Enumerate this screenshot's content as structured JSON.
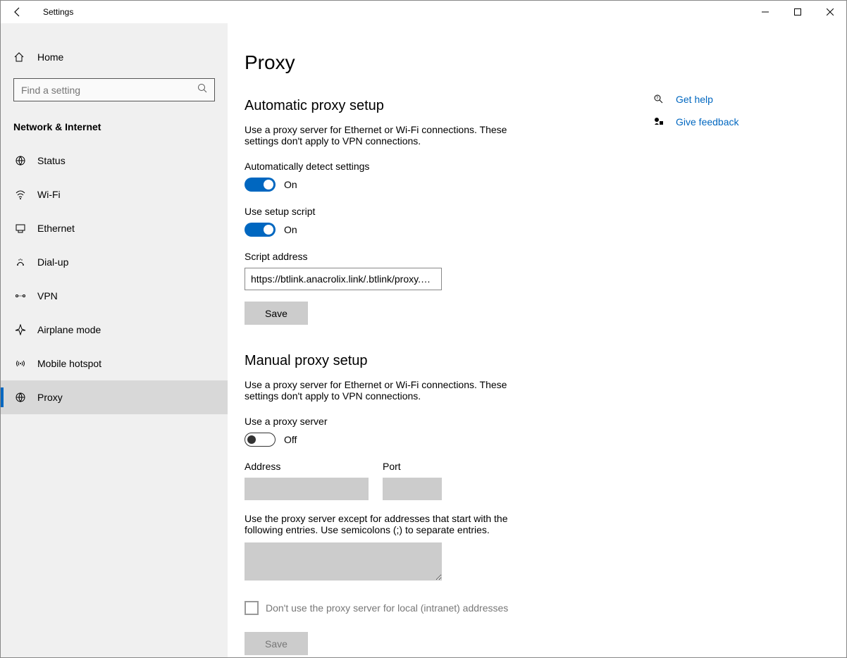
{
  "window": {
    "title": "Settings"
  },
  "sidebar": {
    "home_label": "Home",
    "search_placeholder": "Find a setting",
    "category_label": "Network & Internet",
    "items": [
      {
        "label": "Status"
      },
      {
        "label": "Wi-Fi"
      },
      {
        "label": "Ethernet"
      },
      {
        "label": "Dial-up"
      },
      {
        "label": "VPN"
      },
      {
        "label": "Airplane mode"
      },
      {
        "label": "Mobile hotspot"
      },
      {
        "label": "Proxy"
      }
    ]
  },
  "page": {
    "title": "Proxy"
  },
  "auto": {
    "heading": "Automatic proxy setup",
    "desc": "Use a proxy server for Ethernet or Wi-Fi connections. These settings don't apply to VPN connections.",
    "detect_label": "Automatically detect settings",
    "detect_state": "On",
    "script_toggle_label": "Use setup script",
    "script_toggle_state": "On",
    "script_addr_label": "Script address",
    "script_addr_value": "https://btlink.anacrolix.link/.btlink/proxy.pac",
    "save_label": "Save"
  },
  "manual": {
    "heading": "Manual proxy setup",
    "desc": "Use a proxy server for Ethernet or Wi-Fi connections. These settings don't apply to VPN connections.",
    "use_label": "Use a proxy server",
    "use_state": "Off",
    "address_label": "Address",
    "port_label": "Port",
    "except_desc": "Use the proxy server except for addresses that start with the following entries. Use semicolons (;) to separate entries.",
    "local_label": "Don't use the proxy server for local (intranet) addresses",
    "save_label": "Save"
  },
  "help": {
    "get_help": "Get help",
    "feedback": "Give feedback"
  }
}
